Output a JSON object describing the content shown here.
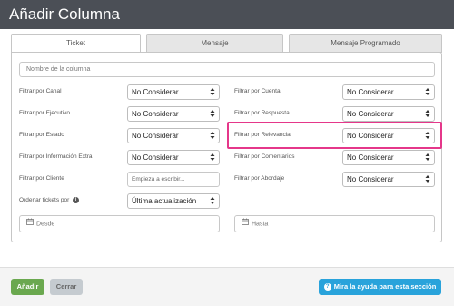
{
  "window": {
    "title": "Añadir Columna"
  },
  "tabs": [
    {
      "label": "Ticket",
      "active": true
    },
    {
      "label": "Mensaje",
      "active": false
    },
    {
      "label": "Mensaje Programado",
      "active": false
    }
  ],
  "form": {
    "column_name_placeholder": "Nombre de la columna",
    "left": [
      {
        "label": "Filtrar por Canal",
        "value": "No Considerar"
      },
      {
        "label": "Filtrar por Ejecutivo",
        "value": "No Considerar"
      },
      {
        "label": "Filtrar por Estado",
        "value": "No Considerar"
      },
      {
        "label": "Filtrar por Información Extra",
        "value": "No Considerar"
      }
    ],
    "client": {
      "label": "Filtrar por Cliente",
      "placeholder": "Empieza a escribir..."
    },
    "order": {
      "label": "Ordenar tickets por",
      "value": "Última actualización"
    },
    "right": [
      {
        "label": "Filtrar por Cuenta",
        "value": "No Considerar"
      },
      {
        "label": "Filtrar por Respuesta",
        "value": "No Considerar"
      },
      {
        "label": "Filtrar por Relevancia",
        "value": "No Considerar"
      },
      {
        "label": "Filtrar por Comentarios",
        "value": "No Considerar"
      },
      {
        "label": "Filtrar por Abordaje",
        "value": "No Considerar"
      }
    ],
    "date_from_placeholder": "Desde",
    "date_to_placeholder": "Hasta"
  },
  "footer": {
    "add_label": "Añadir",
    "close_label": "Cerrar",
    "help_label": "Mira la ayuda para esta sección"
  },
  "colors": {
    "header": "#4b4f56",
    "add_button": "#6aa84f",
    "help_button": "#29a3db",
    "highlight": "#e5378a"
  },
  "icons": [
    "calendar-icon",
    "info-icon",
    "help-circle-icon",
    "select-caret-icon"
  ]
}
